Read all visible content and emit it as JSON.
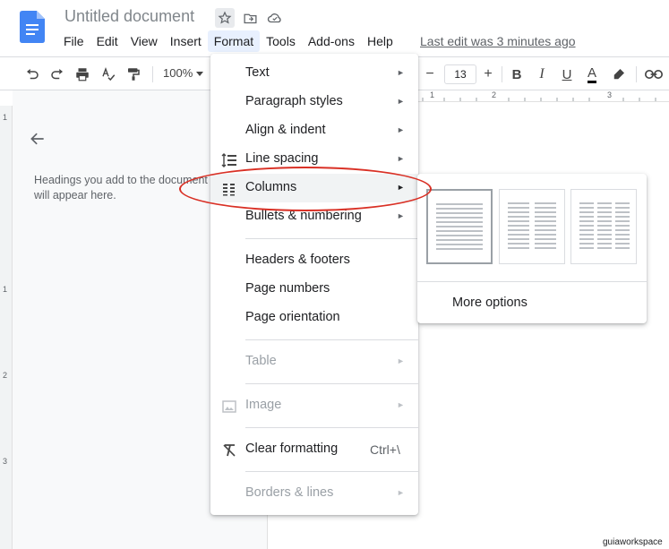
{
  "header": {
    "doc_title": "Untitled document",
    "icons": [
      "star-icon",
      "move-to-folder-icon",
      "cloud-status-icon"
    ],
    "menus": [
      "File",
      "Edit",
      "View",
      "Insert",
      "Format",
      "Tools",
      "Add-ons",
      "Help"
    ],
    "active_menu": "Format",
    "last_edit": "Last edit was 3 minutes ago"
  },
  "toolbar": {
    "zoom": "100%",
    "font_size": "13",
    "minus": "−",
    "plus": "+",
    "bold": "B",
    "italic": "I",
    "underline": "U",
    "text_color": "A"
  },
  "ruler": {
    "marks": [
      "1",
      "2",
      "3"
    ],
    "left_marks": [
      "1",
      "1",
      "2",
      "3"
    ]
  },
  "outline": {
    "hint": "Headings you add to the document will appear here."
  },
  "format_menu": {
    "items": [
      {
        "label": "Text",
        "arrow": "►"
      },
      {
        "label": "Paragraph styles",
        "arrow": "►"
      },
      {
        "label": "Align & indent",
        "arrow": "►"
      },
      {
        "label": "Line spacing",
        "arrow": "►",
        "icon": "line-spacing-icon"
      },
      {
        "label": "Columns",
        "arrow": "►",
        "icon": "columns-icon"
      },
      {
        "label": "Bullets & numbering",
        "arrow": "►"
      },
      {
        "label": "Headers & footers"
      },
      {
        "label": "Page numbers"
      },
      {
        "label": "Page orientation"
      },
      {
        "label": "Table",
        "arrow": "►",
        "disabled": true
      },
      {
        "label": "Image",
        "arrow": "►",
        "disabled": true,
        "icon": "image-icon"
      },
      {
        "label": "Clear formatting",
        "shortcut": "Ctrl+\\",
        "icon": "clear-formatting-icon"
      },
      {
        "label": "Borders & lines",
        "arrow": "►",
        "disabled": true
      }
    ]
  },
  "columns_submenu": {
    "options": [
      "one-column",
      "two-columns",
      "three-columns"
    ],
    "selected": "one-column",
    "more_options": "More options"
  },
  "colors": {
    "accent": "#4285f4",
    "highlight_ellipse": "#d93025",
    "menu_active_bg": "#e8f0fe"
  },
  "watermark": "guiaworkspace"
}
